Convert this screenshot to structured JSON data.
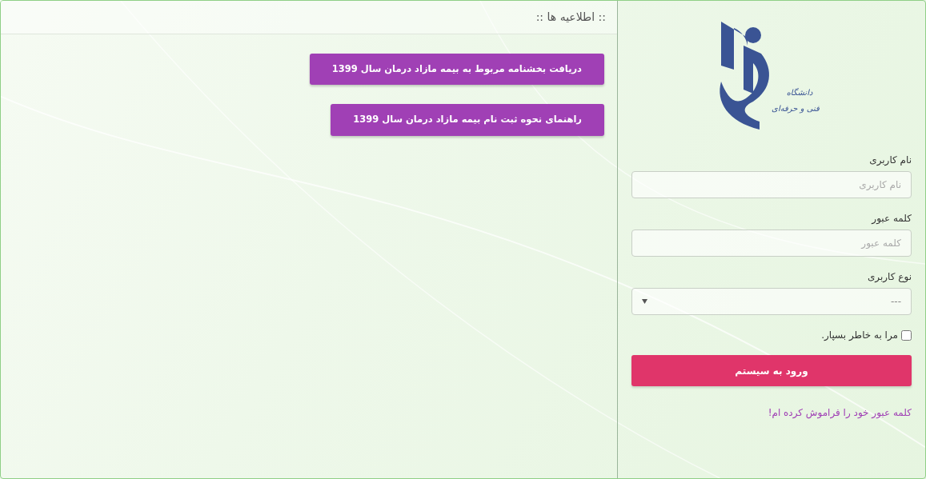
{
  "logo": {
    "caption": [
      "دانشگاه",
      "فنی و حرفه‌ای"
    ]
  },
  "login": {
    "fields": [
      {
        "kind": "text",
        "label": "نام کاربری",
        "placeholder": "نام کاربری"
      },
      {
        "kind": "password",
        "label": "کلمه عبور",
        "placeholder": "کلمه عبور"
      },
      {
        "kind": "select",
        "label": "نوع کاربری",
        "value": "---"
      }
    ],
    "remember": {
      "label": "مرا به خاطر بسپار.",
      "checked": false
    },
    "submit": "ورود به سیستم",
    "forgot_link": "کلمه عبور خود را فراموش کرده ام!"
  },
  "announcements": {
    "title": ":: اطلاعیه ها ::",
    "items": [
      "دریافت بخشنامه مربوط به بیمه مازاد درمان سال 1399",
      "راهنمای نحوه ثبت نام بیمه مازاد درمان سال 1399"
    ]
  }
}
